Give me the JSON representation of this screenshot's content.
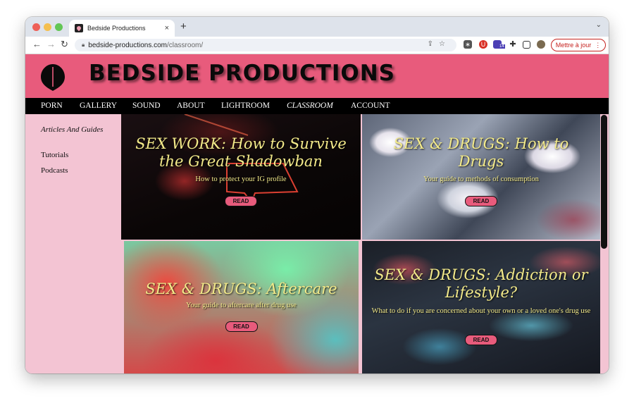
{
  "browser": {
    "tab_title": "Bedside Productions",
    "tab_close": "×",
    "new_tab": "+",
    "url_host": "bedside-productions.com",
    "url_path": "/classroom/",
    "update_label": "Mettre à jour",
    "extension_badge": "14"
  },
  "site": {
    "title": "BEDSIDE PRODUCTIONS",
    "nav": [
      "PORN",
      "GALLERY",
      "SOUND",
      "ABOUT",
      "LIGHTROOM",
      "CLASSROOM",
      "ACCOUNT"
    ],
    "active_nav": "CLASSROOM"
  },
  "sidebar": {
    "items": [
      "Articles And Guides",
      "Tutorials",
      "Podcasts"
    ]
  },
  "cards": [
    {
      "title": "SEX WORK: How to Survive the Great Shadowban",
      "subtitle": "How to protect your IG profile",
      "button": "READ"
    },
    {
      "title": "SEX & DRUGS: How to Drugs",
      "subtitle": "Your guide to methods of consumption",
      "button": "READ"
    },
    {
      "title": "SEX & DRUGS: Aftercare",
      "subtitle": "Your guide to aftercare after drug use",
      "button": "READ"
    },
    {
      "title": "SEX & DRUGS: Addiction or Lifestyle?",
      "subtitle": "What to do if you are concerned about your own or a loved one's drug use",
      "button": "READ"
    }
  ],
  "colors": {
    "banner": "#e85b7c",
    "sidebar": "#f3c4d3",
    "card_text": "#f3ea8a"
  }
}
